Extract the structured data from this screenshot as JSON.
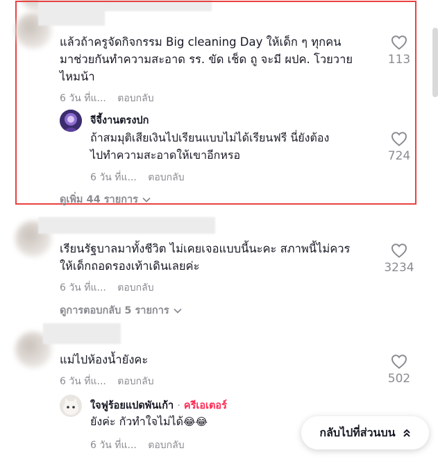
{
  "comments": [
    {
      "text_lines": [
        "แล้วถ้าครูจัดกิจกรรม Big cleaning Day ให้เด็ก ๆ ทุกคน",
        "มาช่วยกันทำความสะอาด รร. ขัด เช็ด ถู จะมี ผปค. โวยวาย",
        "ไหมน้า"
      ],
      "time": "6 วัน ที่แ...",
      "reply_label": "ตอบกลับ",
      "likes": "113",
      "reply": {
        "author": "จีจี้งานตรงปก",
        "text_lines": [
          "ถ้าสมมุติเสียเงินไปเรียนแบบไม่ได้เรียนฟรี นี่ยังต้อง",
          "ไปทำความสะอาดให้เขาอีกหรอ"
        ],
        "time": "6 วัน ที่แ...",
        "reply_label": "ตอบกลับ",
        "likes": "724"
      },
      "more_label": "ดูเพิ่ม 44 รายการ"
    },
    {
      "text_lines": [
        "เรียนรัฐบาลมาทั้งชีวิต ไม่เคยเจอแบบนี้นะคะ สภาพนี้ไม่ควร",
        "ให้เด็กถอดรองเท้าเดินเลยค่ะ"
      ],
      "time": "6 วัน ที่แ...",
      "reply_label": "ตอบกลับ",
      "likes": "3234",
      "more_label": "ดูการตอบกลับ 5 รายการ"
    },
    {
      "text_lines": [
        "แม่ไปห้องน้ำยังคะ"
      ],
      "time": "6 วัน ที่แ...",
      "reply_label": "ตอบกลับ",
      "likes": "502",
      "reply": {
        "author": "ใจฟูร้อยแปดพันเก้า",
        "separator": "·",
        "creator_label": "ครีเอเตอร์",
        "text": "ยังค่ะ กัวทำใจไม่ได้",
        "emoji": "😂😂",
        "time": "6 วัน ที่แ...",
        "reply_label": "ตอบกลับ"
      }
    }
  ],
  "back_to_top": "กลับไปที่ส่วนบน",
  "colors": {
    "highlight": "#e8403f",
    "creator": "#fe2c55",
    "meta": "#8a8b91"
  }
}
